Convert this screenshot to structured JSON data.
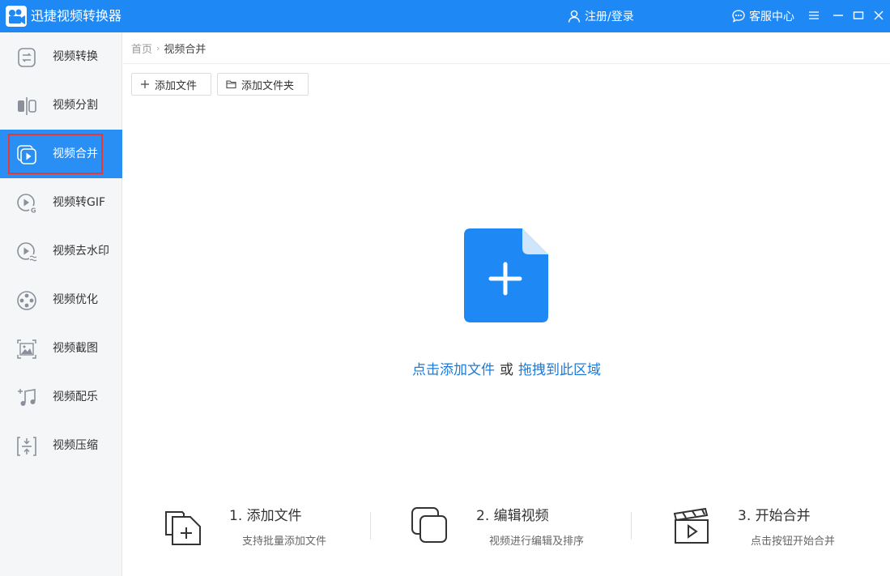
{
  "app": {
    "title": "迅捷视频转换器",
    "login_label": "注册/登录",
    "support_label": "客服中心",
    "accent_color": "#1e88f5"
  },
  "sidebar": {
    "items": [
      {
        "label": "视频转换",
        "icon": "convert-icon"
      },
      {
        "label": "视频分割",
        "icon": "split-icon"
      },
      {
        "label": "视频合并",
        "icon": "merge-icon",
        "active": true
      },
      {
        "label": "视频转GIF",
        "icon": "gif-icon"
      },
      {
        "label": "视频去水印",
        "icon": "watermark-icon"
      },
      {
        "label": "视频优化",
        "icon": "film-reel-icon"
      },
      {
        "label": "视频截图",
        "icon": "screenshot-icon"
      },
      {
        "label": "视频配乐",
        "icon": "music-icon"
      },
      {
        "label": "视频压缩",
        "icon": "compress-icon"
      }
    ]
  },
  "breadcrumb": {
    "home": "首页",
    "current": "视频合并"
  },
  "toolbar": {
    "add_file": "添加文件",
    "add_folder": "添加文件夹"
  },
  "dropzone": {
    "click_text": "点击添加文件",
    "or_text": "或",
    "drag_text": "拖拽到此区域"
  },
  "steps": [
    {
      "title": "1. 添加文件",
      "desc": "支持批量添加文件"
    },
    {
      "title": "2. 编辑视频",
      "desc": "视频进行编辑及排序"
    },
    {
      "title": "3. 开始合并",
      "desc": "点击按钮开始合并"
    }
  ]
}
